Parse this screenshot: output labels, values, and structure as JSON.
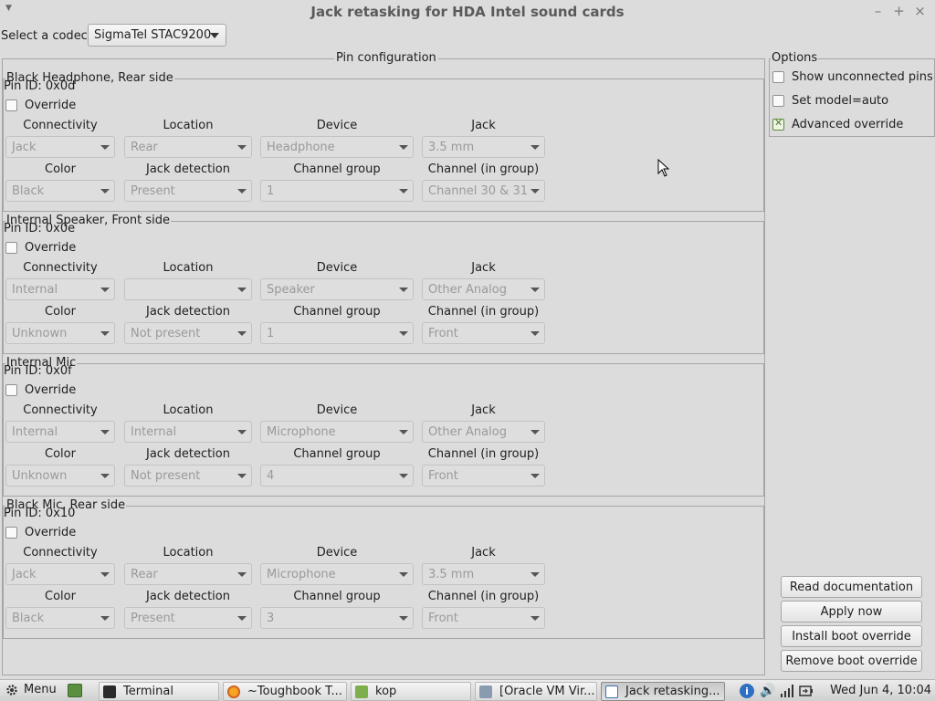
{
  "window": {
    "title": "Jack retasking for HDA Intel sound cards",
    "menu_glyph": "▼",
    "minimize": "–",
    "maximize": "+",
    "close": "×"
  },
  "codec": {
    "label": "Select a codec:",
    "value": "SigmaTel STAC9200"
  },
  "pin_config": {
    "title": "Pin configuration",
    "headers": {
      "connectivity": "Connectivity",
      "location": "Location",
      "device": "Device",
      "jack": "Jack",
      "color": "Color",
      "jack_detection": "Jack detection",
      "channel_group": "Channel group",
      "channel_in_group": "Channel (in group)"
    },
    "override_label": "Override",
    "groups": [
      {
        "title": "Black Headphone, Rear side",
        "pin_id": "Pin ID: 0x0d",
        "connectivity": "Jack",
        "location": "Rear",
        "device": "Headphone",
        "jack": "3.5 mm",
        "color": "Black",
        "jack_detection": "Present",
        "channel_group": "1",
        "channel_in_group": "Channel 30 & 31"
      },
      {
        "title": "Internal Speaker, Front side",
        "pin_id": "Pin ID: 0x0e",
        "connectivity": "Internal",
        "location": "",
        "device": "Speaker",
        "jack": "Other Analog",
        "color": "Unknown",
        "jack_detection": "Not present",
        "channel_group": "1",
        "channel_in_group": "Front"
      },
      {
        "title": "Internal Mic",
        "pin_id": "Pin ID: 0x0f",
        "connectivity": "Internal",
        "location": "Internal",
        "device": "Microphone",
        "jack": "Other Analog",
        "color": "Unknown",
        "jack_detection": "Not present",
        "channel_group": "4",
        "channel_in_group": "Front"
      },
      {
        "title": "Black Mic, Rear side",
        "pin_id": "Pin ID: 0x10",
        "connectivity": "Jack",
        "location": "Rear",
        "device": "Microphone",
        "jack": "3.5 mm",
        "color": "Black",
        "jack_detection": "Present",
        "channel_group": "3",
        "channel_in_group": "Front"
      }
    ]
  },
  "options": {
    "title": "Options",
    "show_unconnected": "Show unconnected pins",
    "set_model_auto": "Set model=auto",
    "advanced_override": "Advanced override"
  },
  "buttons": {
    "read_docs": "Read documentation",
    "apply_now": "Apply now",
    "install_boot": "Install boot override",
    "remove_boot": "Remove boot override"
  },
  "taskbar": {
    "menu": "Menu",
    "items": [
      "Terminal",
      "~Toughbook T...",
      "kop",
      "[Oracle VM Vir...",
      "Jack retasking..."
    ],
    "clock": "Wed Jun  4, 10:04"
  },
  "colors": {
    "accent_check": "#4d7a28",
    "window_bg": "#dcdcdc"
  }
}
